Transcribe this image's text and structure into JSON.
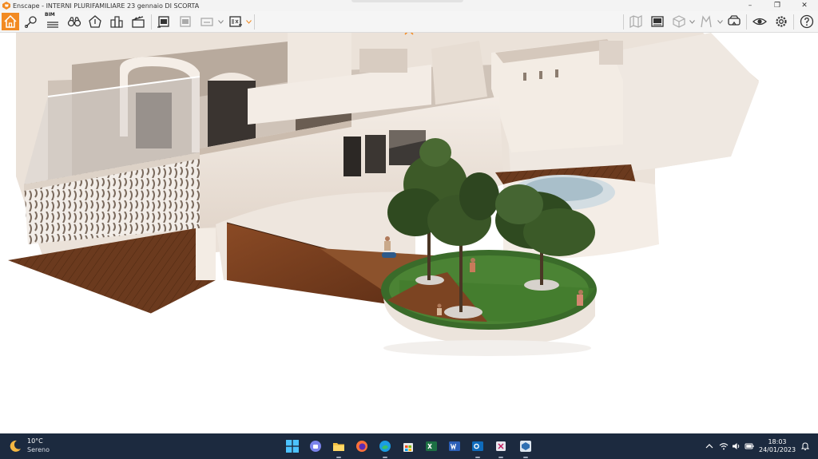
{
  "window": {
    "title": "Enscape - INTERNI PLURIFAMILIARE 23 gennaio DI SCORTA",
    "minimize": "–",
    "restore": "❐",
    "close": "✕"
  },
  "toolbar": {
    "left_icons": [
      "home-icon",
      "location-pin-icon",
      "bim-icon",
      "binoculars-icon",
      "light-view-icon",
      "buildings-icon",
      "clapperboard-icon",
      "screenshot-export-icon",
      "batch-render-icon",
      "skp-export-icon",
      "exe-export-icon"
    ],
    "bim_label": "BIM",
    "right_icons": [
      "minimap-icon",
      "asset-library-icon",
      "cube-view-icon",
      "walk-icon",
      "vr-headset-icon",
      "visual-settings-icon",
      "settings-gear-icon",
      "help-icon"
    ],
    "accent_color": "#f28a22"
  },
  "taskbar": {
    "weather": {
      "temp": "10°C",
      "condition": "Sereno"
    },
    "apps": [
      "windows-start-icon",
      "teams-chat-icon",
      "file-explorer-icon",
      "firefox-icon",
      "edge-icon",
      "microsoft-store-icon",
      "excel-icon",
      "word-icon",
      "outlook-icon",
      "snipping-tool-icon",
      "enscape-icon"
    ],
    "clock": {
      "time": "18:03",
      "date": "24/01/2023"
    }
  }
}
